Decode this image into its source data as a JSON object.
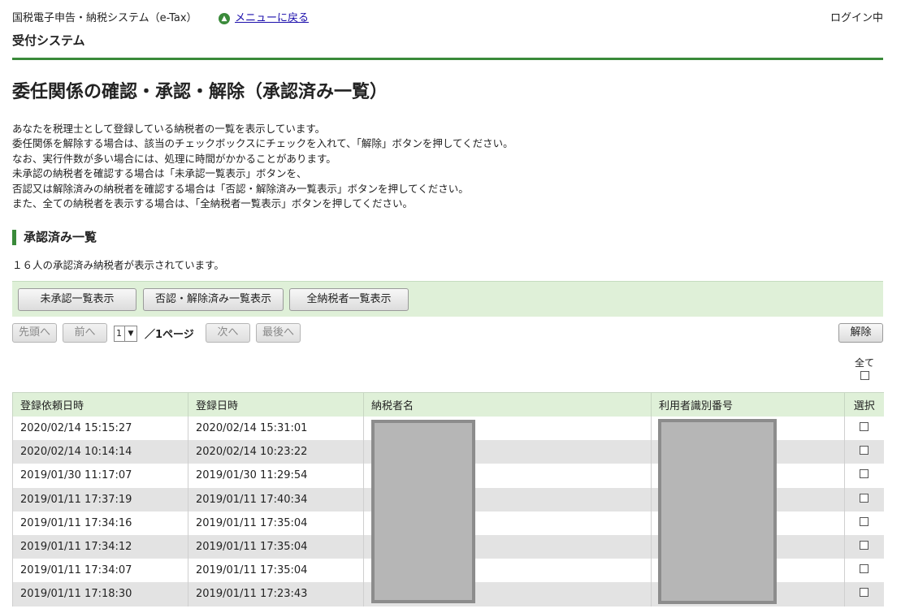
{
  "header": {
    "system_name": "国税電子申告・納税システム（e-Tax）",
    "back_link": "メニューに戻る",
    "login_status": "ログイン中",
    "subsystem": "受付システム"
  },
  "page_title": "委任関係の確認・承認・解除（承認済み一覧）",
  "description": [
    "あなたを税理士として登録している納税者の一覧を表示しています。",
    "委任関係を解除する場合は、該当のチェックボックスにチェックを入れて、「解除」ボタンを押してください。",
    "なお、実行件数が多い場合には、処理に時間がかかることがあります。",
    "未承認の納税者を確認する場合は「未承認一覧表示」ボタンを、",
    "否認又は解除済みの納税者を確認する場合は「否認・解除済み一覧表示」ボタンを押してください。",
    "また、全ての納税者を表示する場合は、「全納税者一覧表示」ボタンを押してください。"
  ],
  "section_title": "承認済み一覧",
  "count_text": "１６人の承認済み納税者が表示されています。",
  "filter_buttons": {
    "unapproved": "未承認一覧表示",
    "rejected": "否認・解除済み一覧表示",
    "all": "全納税者一覧表示"
  },
  "pager": {
    "first": "先頭へ",
    "prev": "前へ",
    "current_page": "1",
    "total_pages": "／1ページ",
    "next": "次へ",
    "last": "最後へ",
    "release": "解除"
  },
  "select_all_label": "全て",
  "table": {
    "headers": [
      "登録依頼日時",
      "登録日時",
      "納税者名",
      "利用者識別番号",
      "選択"
    ],
    "rows": [
      {
        "requested": "2020/02/14 15:15:27",
        "registered": "2020/02/14 15:31:01"
      },
      {
        "requested": "2020/02/14 10:14:14",
        "registered": "2020/02/14 10:23:22"
      },
      {
        "requested": "2019/01/30 11:17:07",
        "registered": "2019/01/30 11:29:54"
      },
      {
        "requested": "2019/01/11 17:37:19",
        "registered": "2019/01/11 17:40:34"
      },
      {
        "requested": "2019/01/11 17:34:16",
        "registered": "2019/01/11 17:35:04"
      },
      {
        "requested": "2019/01/11 17:34:12",
        "registered": "2019/01/11 17:35:04"
      },
      {
        "requested": "2019/01/11 17:34:07",
        "registered": "2019/01/11 17:35:04"
      },
      {
        "requested": "2019/01/11 17:18:30",
        "registered": "2019/01/11 17:23:43"
      }
    ]
  },
  "colors": {
    "accent_green": "#3a8a3a",
    "header_bg": "#dff0d8",
    "stripe": "#e3e3e3"
  }
}
